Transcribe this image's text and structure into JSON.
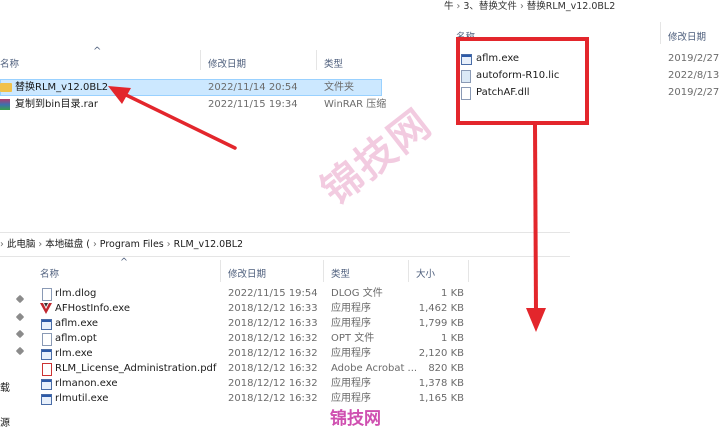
{
  "top_left": {
    "col_name": "名称",
    "col_modified": "修改日期",
    "col_type": "类型",
    "rows": [
      {
        "name": "替换RLM_v12.0BL2",
        "date": "2022/11/14 20:54",
        "type": "文件夹",
        "icon": "folder-icon"
      },
      {
        "name": "复制到bin目录.rar",
        "date": "2022/11/15 19:34",
        "type": "WinRAR 压缩",
        "icon": "rar-icon"
      }
    ]
  },
  "top_right": {
    "breadcrumb": [
      "牛",
      "3、替换文件",
      "替换RLM_v12.0BL2"
    ],
    "col_name": "名称",
    "col_modified": "修改日期",
    "rows": [
      {
        "name": "aflm.exe",
        "date": "2019/2/27",
        "icon": "exe-icon"
      },
      {
        "name": "autoform-R10.lic",
        "date": "2022/8/13",
        "icon": "lic-icon"
      },
      {
        "name": "PatchAF.dll",
        "date": "2019/2/27",
        "icon": "dll-icon"
      }
    ]
  },
  "bottom": {
    "breadcrumb": [
      "此电脑",
      "本地磁盘 (",
      "Program Files",
      "RLM_v12.0BL2"
    ],
    "col_name": "名称",
    "col_modified": "修改日期",
    "col_type": "类型",
    "col_size": "大小",
    "left_labels": [
      "载",
      "源"
    ],
    "rows": [
      {
        "name": "rlm.dlog",
        "date": "2022/11/15 19:54",
        "type": "DLOG 文件",
        "size": "1 KB",
        "icon": "doc-icon"
      },
      {
        "name": "AFHostInfo.exe",
        "date": "2018/12/12 16:33",
        "type": "应用程序",
        "size": "1,462 KB",
        "icon": "af-icon"
      },
      {
        "name": "aflm.exe",
        "date": "2018/12/12 16:33",
        "type": "应用程序",
        "size": "1,799 KB",
        "icon": "exe-icon"
      },
      {
        "name": "aflm.opt",
        "date": "2018/12/12 16:32",
        "type": "OPT 文件",
        "size": "1 KB",
        "icon": "doc-icon"
      },
      {
        "name": "rlm.exe",
        "date": "2018/12/12 16:32",
        "type": "应用程序",
        "size": "2,120 KB",
        "icon": "exe-icon"
      },
      {
        "name": "RLM_License_Administration.pdf",
        "date": "2018/12/12 16:32",
        "type": "Adobe Acrobat ...",
        "size": "820 KB",
        "icon": "pdf-icon"
      },
      {
        "name": "rlmanon.exe",
        "date": "2018/12/12 16:32",
        "type": "应用程序",
        "size": "1,378 KB",
        "icon": "exe-icon"
      },
      {
        "name": "rlmutil.exe",
        "date": "2018/12/12 16:32",
        "type": "应用程序",
        "size": "1,165 KB",
        "icon": "exe-icon"
      }
    ]
  },
  "watermark": {
    "large": "锦技网",
    "small": "锦技网"
  },
  "colors": {
    "arrow": "#e3262c",
    "selection": "#cce8ff",
    "watermark": "#e9a1c8"
  }
}
